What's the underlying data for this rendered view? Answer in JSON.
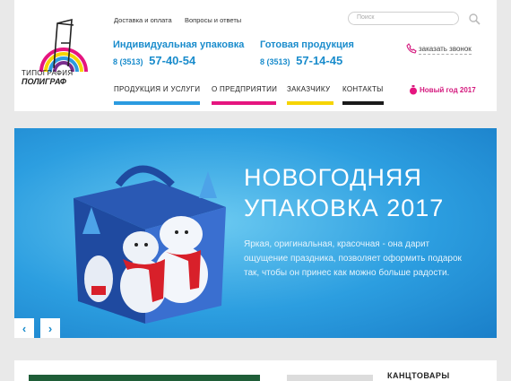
{
  "colors": {
    "accent_blue": "#1a8ccc",
    "nav_blue": "#2b9be0",
    "nav_magenta": "#e5157f",
    "nav_yellow": "#f6d400",
    "nav_black": "#1a1a1a",
    "new_year_pink": "#d4187d",
    "green_block": "#1f5e38"
  },
  "logo": {
    "line1": "ТИПОГРАФИЯ",
    "line2": "ПОЛИГРАФ"
  },
  "top_links": {
    "delivery": "Доставка и оплата",
    "faq": "Вопросы и ответы"
  },
  "search": {
    "placeholder": "Поиск",
    "icon": "search-icon"
  },
  "phones": {
    "individual": {
      "title": "Индивидуальная упаковка",
      "code": "8 (3513)",
      "number": "57-40-54"
    },
    "ready": {
      "title": "Готовая продукция",
      "code": "8 (3513)",
      "number": "57-14-45"
    }
  },
  "callback": {
    "label": "заказать звонок",
    "icon": "phone-icon"
  },
  "nav": {
    "products": "ПРОДУКЦИЯ И УСЛУГИ",
    "about": "О ПРЕДПРИЯТИИ",
    "customer": "ЗАКАЗЧИКУ",
    "contacts": "КОНТАКТЫ",
    "new_year": "Новый год 2017",
    "new_year_icon": "ornament-icon"
  },
  "banner": {
    "title_line1": "НОВОГОДНЯЯ",
    "title_line2": "УПАКОВКА 2017",
    "text": "Яркая, оригинальная, красочная - она дарит ощущение праздника, позволяет оформить подарок так, чтобы он принес как можно больше радости.",
    "prev_icon": "chevron-left-icon",
    "next_icon": "chevron-right-icon",
    "prev_glyph": "‹",
    "next_glyph": "›"
  },
  "bottom": {
    "heading": "КАНЦТОВАРЫ"
  }
}
